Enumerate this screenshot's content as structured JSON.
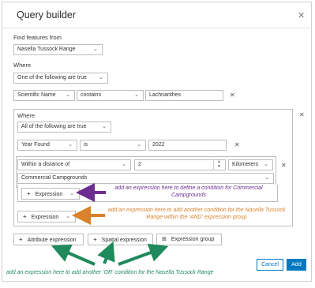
{
  "dialog": {
    "title": "Query builder",
    "close_icon": "close-icon"
  },
  "find_features": {
    "label": "Find features from",
    "layer": "Nasella Tussock Range"
  },
  "where": {
    "label": "Where",
    "mode": "One of the following are true"
  },
  "expression1": {
    "field": "Scientific Name",
    "operator": "contains",
    "value": "Lachnanthes"
  },
  "group": {
    "label": "Where",
    "mode": "All of the following are true",
    "expr_year": {
      "field": "Year Found",
      "operator": "is",
      "value": "2022"
    },
    "expr_distance": {
      "operator": "Within a distance of",
      "value": "2",
      "unit": "Kilometers",
      "layer": "Commercial Campgrounds"
    },
    "inner_expression_label": "Expression",
    "outer_expression_label": "Expression"
  },
  "bottom_buttons": {
    "attribute": "Attribute expression",
    "spatial": "Spatial expression",
    "group": "Expression group"
  },
  "footer": {
    "cancel": "Cancel",
    "add": "Add"
  },
  "annotations": {
    "purple": "add an expression here to define a condition for Commercial Campgrounds",
    "orange": "add an expression here to add another condition for the Nasella Tussock Range within the 'AND' expression group",
    "green": "add an expression here to add another 'OR' condition for the Nasella Tussock Range"
  },
  "colors": {
    "purple": "#6b2e8f",
    "orange": "#d9822b",
    "green": "#1f8a5b",
    "accent": "#0079c1"
  }
}
